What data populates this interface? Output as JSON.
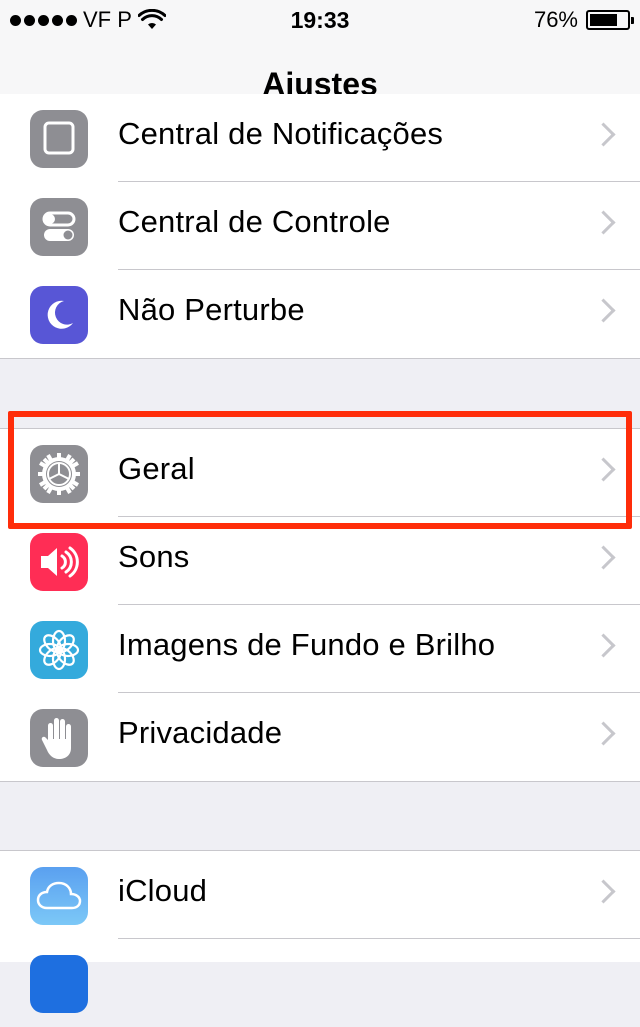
{
  "status_bar": {
    "carrier": "VF P",
    "time": "19:33",
    "battery_percent": "76%",
    "battery_level": 0.76
  },
  "nav": {
    "title": "Ajustes"
  },
  "groups": [
    {
      "items": [
        {
          "label": "Central de Notificações",
          "icon": "notification-center-icon",
          "color": "#8e8e93"
        },
        {
          "label": "Central de Controle",
          "icon": "control-center-icon",
          "color": "#8e8e93"
        },
        {
          "label": "Não Perturbe",
          "icon": "moon-icon",
          "color": "#5856d6"
        }
      ]
    },
    {
      "items": [
        {
          "label": "Geral",
          "icon": "gear-icon",
          "color": "#8e8e93"
        },
        {
          "label": "Sons",
          "icon": "speaker-icon",
          "color": "#ff2d55"
        },
        {
          "label": "Imagens de Fundo e Brilho",
          "icon": "flower-icon",
          "color": "#34aadc"
        },
        {
          "label": "Privacidade",
          "icon": "hand-icon",
          "color": "#8e8e93"
        }
      ]
    },
    {
      "items": [
        {
          "label": "iCloud",
          "icon": "cloud-icon",
          "color": "#5aa0f0"
        }
      ]
    }
  ],
  "highlight_color": "#ff2d0a"
}
